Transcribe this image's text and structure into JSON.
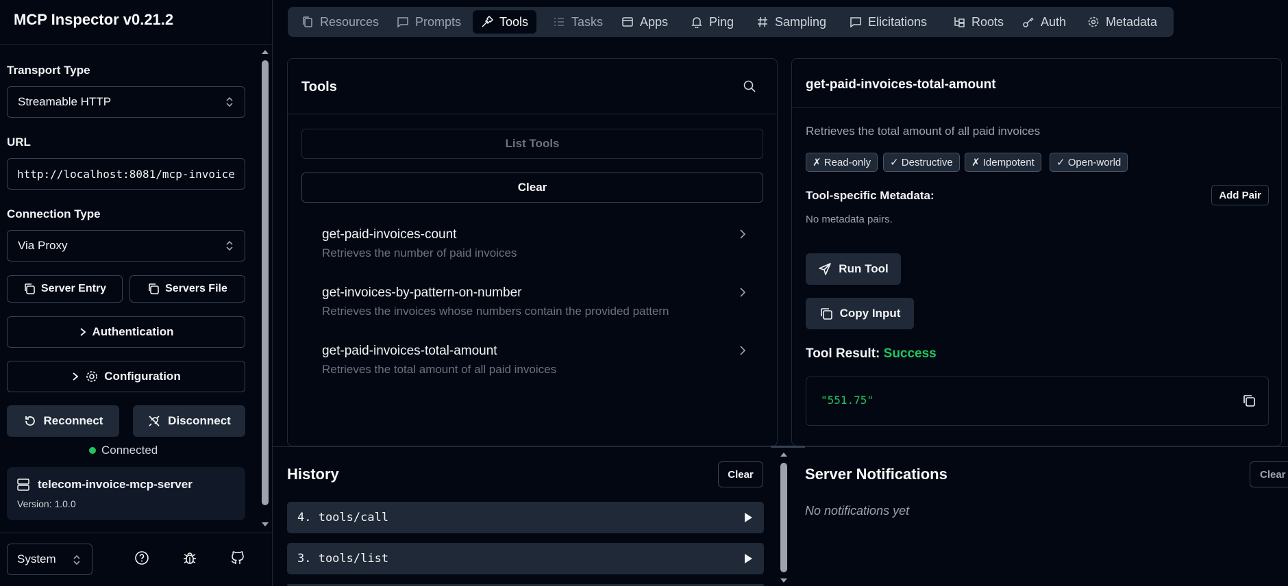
{
  "app": {
    "title": "MCP Inspector v0.21.2"
  },
  "sidebar": {
    "transport_label": "Transport Type",
    "transport_value": "Streamable HTTP",
    "url_label": "URL",
    "url_value": "http://localhost:8081/mcp-invoice",
    "connection_label": "Connection Type",
    "connection_value": "Via Proxy",
    "server_entry_label": "Server Entry",
    "servers_file_label": "Servers File",
    "authentication_label": "Authentication",
    "configuration_label": "Configuration",
    "reconnect_label": "Reconnect",
    "disconnect_label": "Disconnect",
    "status_text": "Connected",
    "server_name": "telecom-invoice-mcp-server",
    "server_version": "Version: 1.0.0",
    "theme_value": "System"
  },
  "tabs": [
    {
      "label": "Resources",
      "icon": "files-icon"
    },
    {
      "label": "Prompts",
      "icon": "message-icon"
    },
    {
      "label": "Tools",
      "icon": "hammer-icon"
    },
    {
      "label": "Tasks",
      "icon": "list-icon"
    },
    {
      "label": "Apps",
      "icon": "app-window-icon"
    },
    {
      "label": "Ping",
      "icon": "bell-icon"
    },
    {
      "label": "Sampling",
      "icon": "hash-icon"
    },
    {
      "label": "Elicitations",
      "icon": "message-icon"
    },
    {
      "label": "Roots",
      "icon": "folder-tree-icon"
    },
    {
      "label": "Auth",
      "icon": "key-icon"
    },
    {
      "label": "Metadata",
      "icon": "gear-icon"
    }
  ],
  "tools_panel": {
    "title": "Tools",
    "list_tools_label": "List Tools",
    "clear_label": "Clear",
    "items": [
      {
        "name": "get-paid-invoices-count",
        "description": "Retrieves the number of paid invoices"
      },
      {
        "name": "get-invoices-by-pattern-on-number",
        "description": "Retrieves the invoices whose numbers contain the provided pattern"
      },
      {
        "name": "get-paid-invoices-total-amount",
        "description": "Retrieves the total amount of all paid invoices"
      }
    ]
  },
  "detail": {
    "title": "get-paid-invoices-total-amount",
    "description": "Retrieves the total amount of all paid invoices",
    "badges": [
      "✗ Read-only",
      "✓ Destructive",
      "✗ Idempotent",
      "✓ Open-world"
    ],
    "metadata_label": "Tool-specific Metadata:",
    "add_pair_label": "Add Pair",
    "no_metadata_text": "No metadata pairs.",
    "run_tool_label": "Run Tool",
    "copy_input_label": "Copy Input",
    "result_label": "Tool Result:",
    "result_status": "Success",
    "result_value": "\"551.75\""
  },
  "history": {
    "title": "History",
    "clear_label": "Clear",
    "items": [
      "4. tools/call",
      "3. tools/list"
    ]
  },
  "notifications": {
    "title": "Server Notifications",
    "clear_label": "Clear",
    "empty_text": "No notifications yet"
  },
  "colors": {
    "success": "#22c55e",
    "background": "#030712",
    "surface": "#1f2937"
  }
}
